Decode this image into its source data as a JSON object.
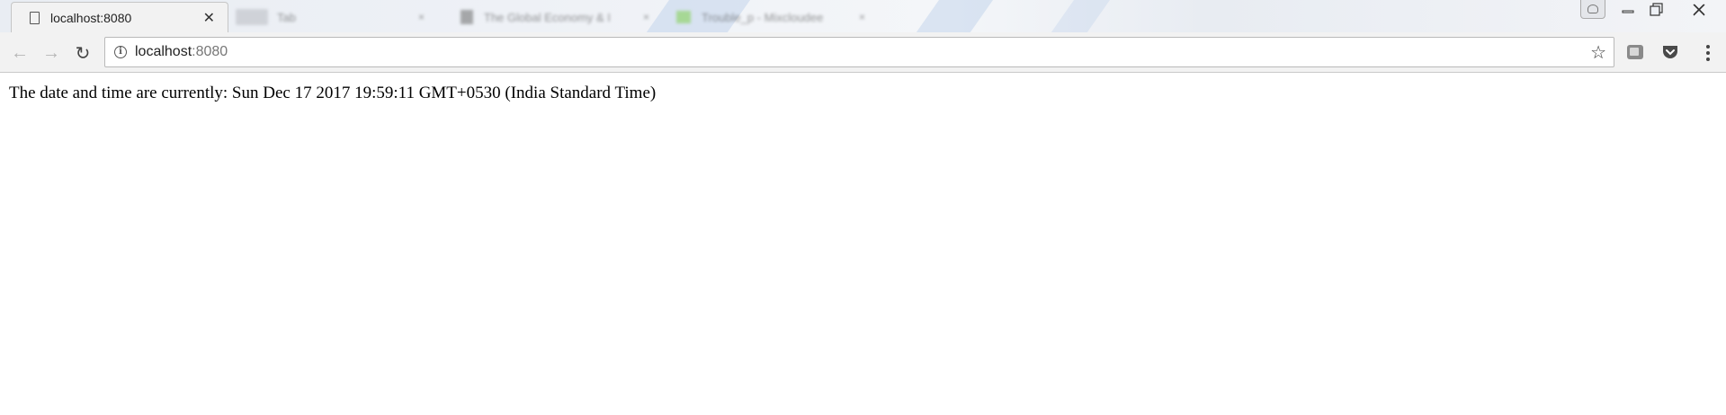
{
  "browser": {
    "tabs": [
      {
        "title": "localhost:8080",
        "active": true,
        "close_glyph": "✕"
      },
      {
        "title": "Tab",
        "active": false,
        "close_glyph": "×"
      },
      {
        "title": "The Global Economy & I",
        "active": false,
        "close_glyph": "×"
      },
      {
        "title": "Trouble_p - Mixcloudee",
        "active": false,
        "close_glyph": "×"
      }
    ],
    "window_controls": {
      "minimize_icon": "minimize-icon",
      "restore_icon": "restore-icon",
      "close_icon": "close-icon"
    },
    "address_bar": {
      "host": "localhost",
      "port": ":8080"
    },
    "icons": {
      "back": "←",
      "forward": "→",
      "reload": "↻",
      "info": "i",
      "star": "☆"
    },
    "colors": {
      "nav_disabled": "#b5b5b5",
      "toolbar_bg": "#f2f2f2",
      "tabstrip_bg": "#eceff4"
    }
  },
  "page": {
    "text": "The date and time are currently: Sun Dec 17 2017 19:59:11 GMT+0530 (India Standard Time)"
  }
}
